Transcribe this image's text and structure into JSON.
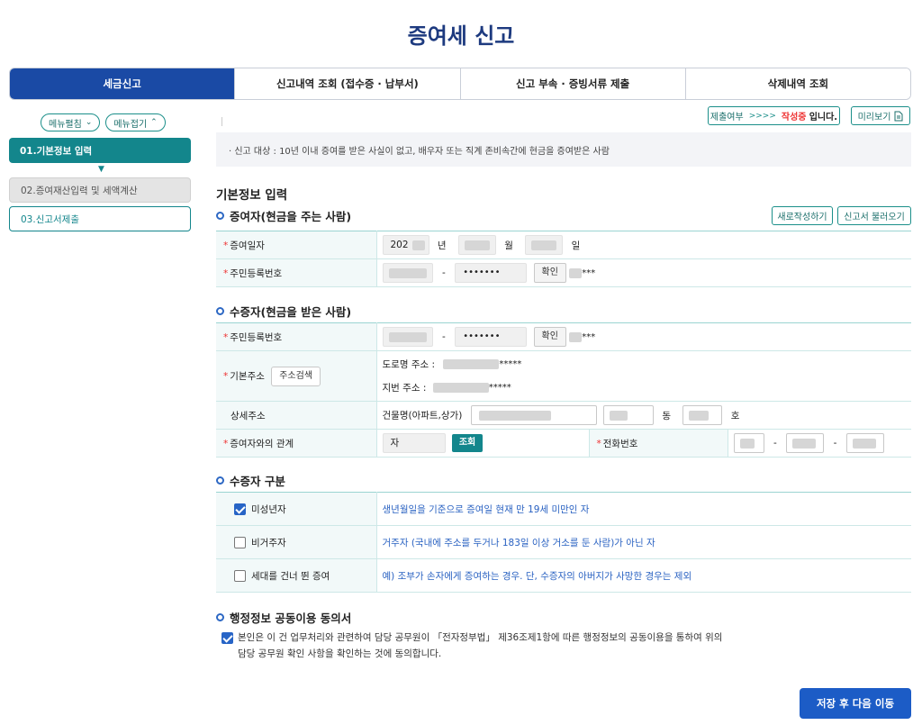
{
  "page": {
    "title": "증여세 신고"
  },
  "tabs": [
    {
      "label": "세금신고",
      "active": true
    },
    {
      "label": "신고내역 조회 (접수증 · 납부서)"
    },
    {
      "label": "신고 부속 · 증빙서류 제출"
    },
    {
      "label": "삭제내역 조회"
    }
  ],
  "sidebar": {
    "expand_label": "메뉴펼침",
    "collapse_label": "메뉴접기",
    "steps": [
      {
        "label": "01.기본정보 입력",
        "state": "active"
      },
      {
        "label": "02.증여재산입력 및 세액계산",
        "state": "disabled"
      },
      {
        "label": "03.신고서제출",
        "state": "normal"
      }
    ]
  },
  "status": {
    "label": "제출여부",
    "arrows": ">>>>",
    "state": "작성중",
    "tail": "입니다."
  },
  "preview_label": "미리보기",
  "notice": "· 신고 대상 : 10년 이내 증여를 받은 사실이 없고, 배우자 또는 직계 존비속간에 현금을 증여받은 사람",
  "section_title": "기본정보 입력",
  "donor": {
    "heading": "증여자(현금을 주는 사람)",
    "new_button": "새로작성하기",
    "load_button": "신고서 불러오기",
    "date_label": "증여일자",
    "year_prefix": "202",
    "year_unit": "년",
    "month_unit": "월",
    "day_unit": "일",
    "rrn_label": "주민등록번호",
    "rrn_mask": "•••••••",
    "confirm_label": "확인",
    "confirm_mask": "***"
  },
  "recipient": {
    "heading": "수증자(현금을 받은 사람)",
    "rrn_label": "주민등록번호",
    "rrn_mask": "•••••••",
    "confirm_label": "확인",
    "confirm_mask": "***",
    "address_label": "기본주소",
    "address_search": "주소검색",
    "road_label": "도로명 주소 :",
    "road_mask": "*****",
    "jibun_label": "지번 주소 :",
    "jibun_mask": "*****",
    "detail_label": "상세주소",
    "building_label": "건물명(아파트,상가)",
    "dong_unit": "동",
    "ho_unit": "호",
    "relation_label": "증여자와의 관계",
    "relation_value": "자",
    "lookup_button": "조회",
    "phone_label": "전화번호"
  },
  "category": {
    "heading": "수증자 구분",
    "rows": [
      {
        "label": "미성년자",
        "checked": true,
        "desc": "생년월일을 기준으로 증여일 현재 만 19세 미만인 자"
      },
      {
        "label": "비거주자",
        "checked": false,
        "desc": "거주자 (국내에 주소를 두거나 183일 이상 거소를 둔 사람)가 아닌 자"
      },
      {
        "label": "세대를 건너 뛴 증여",
        "checked": false,
        "desc": "예) 조부가 손자에게 증여하는 경우. 단, 수증자의 아버지가 사망한 경우는 제외"
      }
    ]
  },
  "consent": {
    "heading": "행정정보 공동이용 동의서",
    "line1": "본인은 이 건 업무처리와 관련하여 담당 공무원이 「전자정부법」 제36조제1항에 따른 행정정보의 공동이용을 통하여 위의",
    "line2": "담당 공무원 확인 사항을 확인하는 것에 동의합니다.",
    "checked": true
  },
  "save_button": "저장 후 다음 이동",
  "colors": {
    "primary": "#1a4aa5",
    "teal": "#13868c",
    "required": "#e33333",
    "link_blue": "#2a62c2"
  }
}
